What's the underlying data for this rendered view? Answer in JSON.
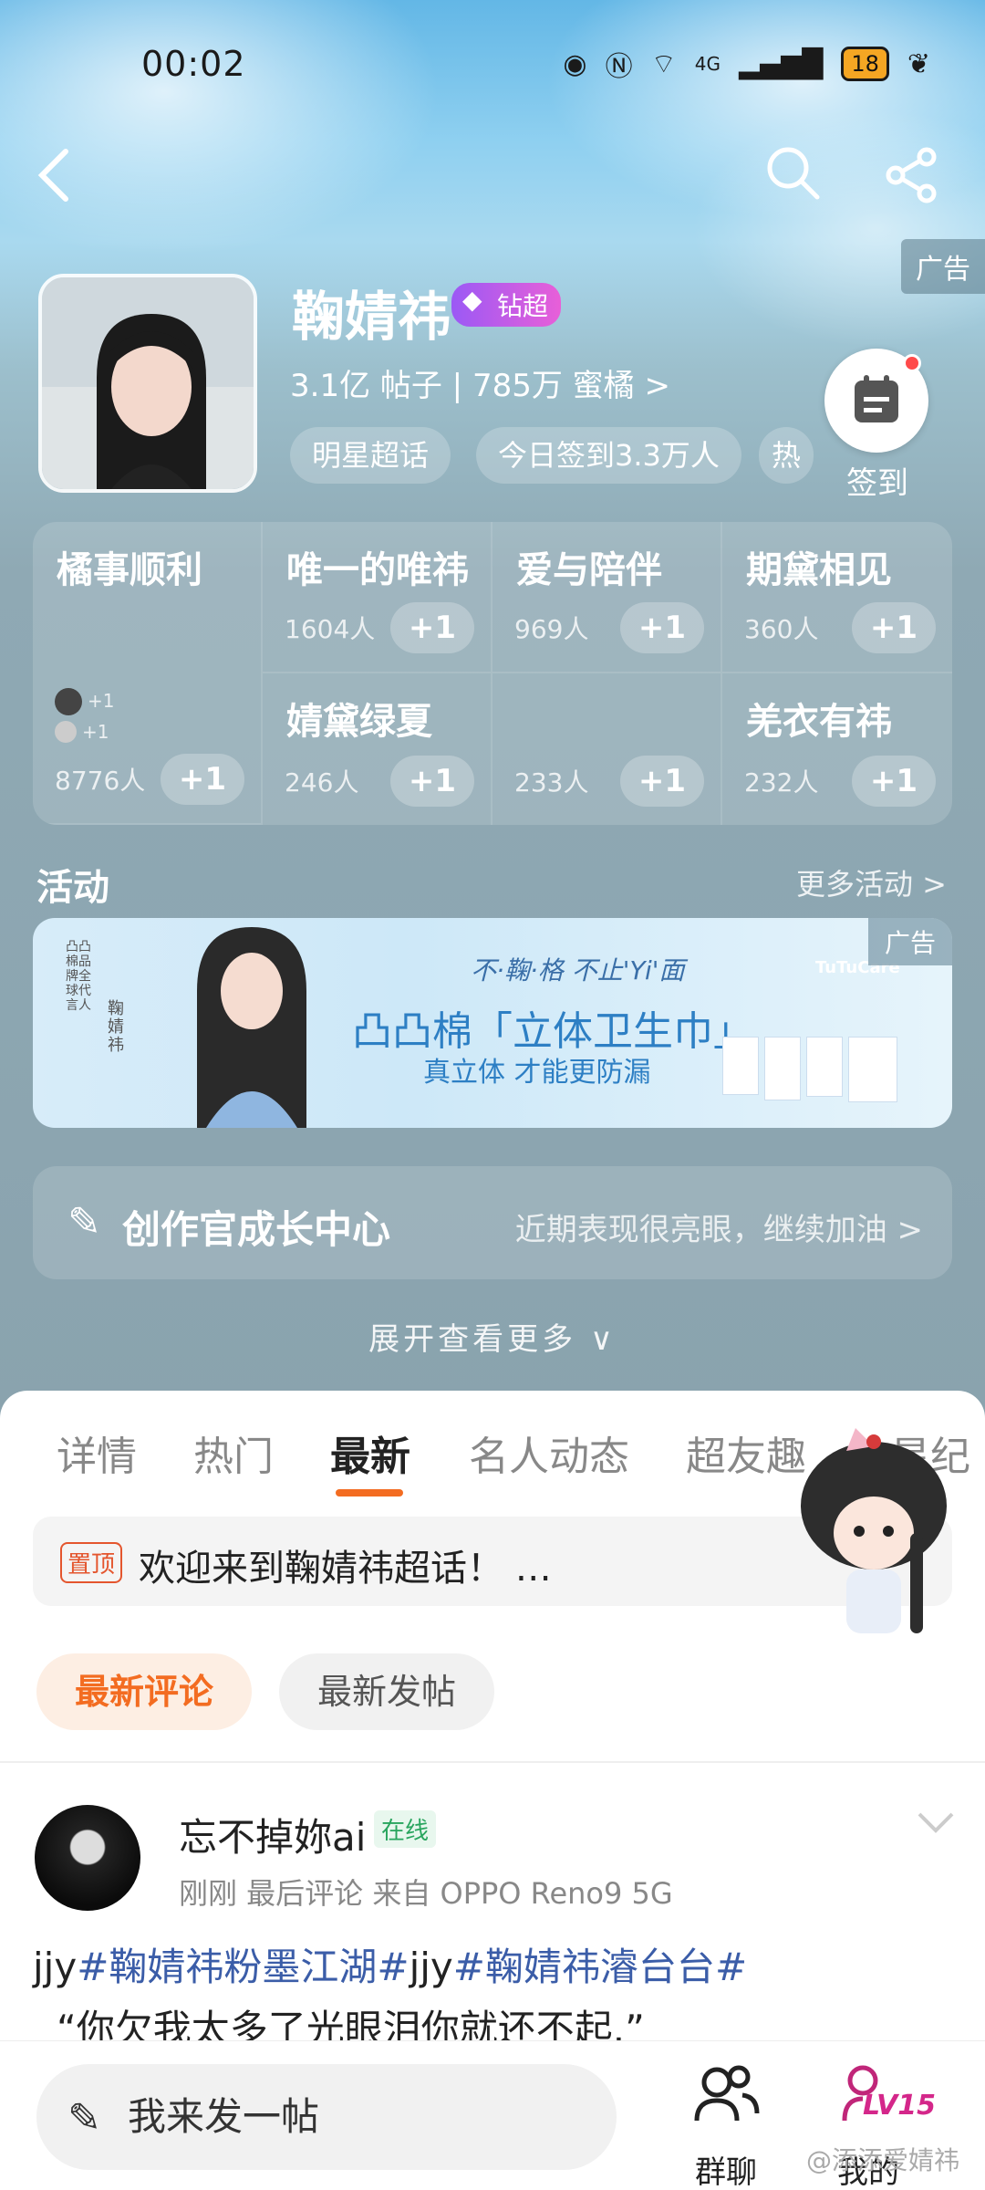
{
  "status_bar": {
    "time": "00:02",
    "network": "4G",
    "battery": "18"
  },
  "header": {
    "back_icon": "back-icon",
    "search_icon": "search-icon",
    "share_icon": "share-icon",
    "ad_label": "广告"
  },
  "profile": {
    "name": "鞠婧祎",
    "badge": "钻超",
    "stats": "3.1亿 帖子 | 785万 蜜橘 >",
    "pills": [
      "明星超话",
      "今日签到3.3万人",
      "热"
    ],
    "sign_label": "签到"
  },
  "groups": [
    {
      "name": "橘事顺利",
      "count": "8776人",
      "plus": "+1",
      "mini": [
        "+1",
        "+1"
      ]
    },
    {
      "name": "唯一的唯祎",
      "count": "1604人",
      "plus": "+1"
    },
    {
      "name": "爱与陪伴",
      "count": "969人",
      "plus": "+1"
    },
    {
      "name": "期黛相见",
      "count": "360人",
      "plus": "+1"
    },
    {
      "name": "婧黛绿夏",
      "count": "246人",
      "plus": "+1"
    },
    {
      "name": "",
      "count": "233人",
      "plus": "+1"
    },
    {
      "name": "羌衣有祎",
      "count": "232人",
      "plus": "+1"
    }
  ],
  "activity": {
    "title": "活动",
    "more": "更多活动 >",
    "banner": {
      "ad_label": "广告",
      "brand_line": "凸凸棉「立体卫生巾」",
      "sub_line": "真立体 才能更防漏",
      "logo": "TuTuCare",
      "script_text": "不·鞠·格 不止'Yi'面",
      "side_text": "凸凸棉品牌全球代言人",
      "side_name": "鞠婧祎"
    }
  },
  "creator": {
    "title": "创作官成长中心",
    "desc": "近期表现很亮眼，继续加油 >"
  },
  "expand_label": "展开查看更多 ∨",
  "tabs": [
    "详情",
    "热门",
    "最新",
    "名人动态",
    "超友趣",
    "星纪"
  ],
  "active_tab": "最新",
  "pinned": {
    "tag": "置顶",
    "text": "欢迎来到鞠婧祎超话！ …"
  },
  "filters": [
    "最新评论",
    "最新发帖"
  ],
  "post": {
    "user": "忘不掉妳ai",
    "online": "在线",
    "meta": "刚刚 最后评论  来自 OPPO Reno9 5G",
    "line1_parts": [
      "jjy",
      "#鞠婧祎粉墨江湖#",
      "jjy",
      "#鞠婧祎濬台台#"
    ],
    "line2": "“你欠我太多了光眼泪你就还不起.”"
  },
  "bottom_bar": {
    "compose_placeholder": "我来发一帖",
    "group_chat": "群聊",
    "mine": "我的",
    "level": "LV15",
    "watermark": "@添添爱婧祎"
  },
  "colors": {
    "accent": "#f36c21",
    "hashtag": "#3b5da8",
    "online": "#29a55e",
    "level": "#d4278a"
  }
}
